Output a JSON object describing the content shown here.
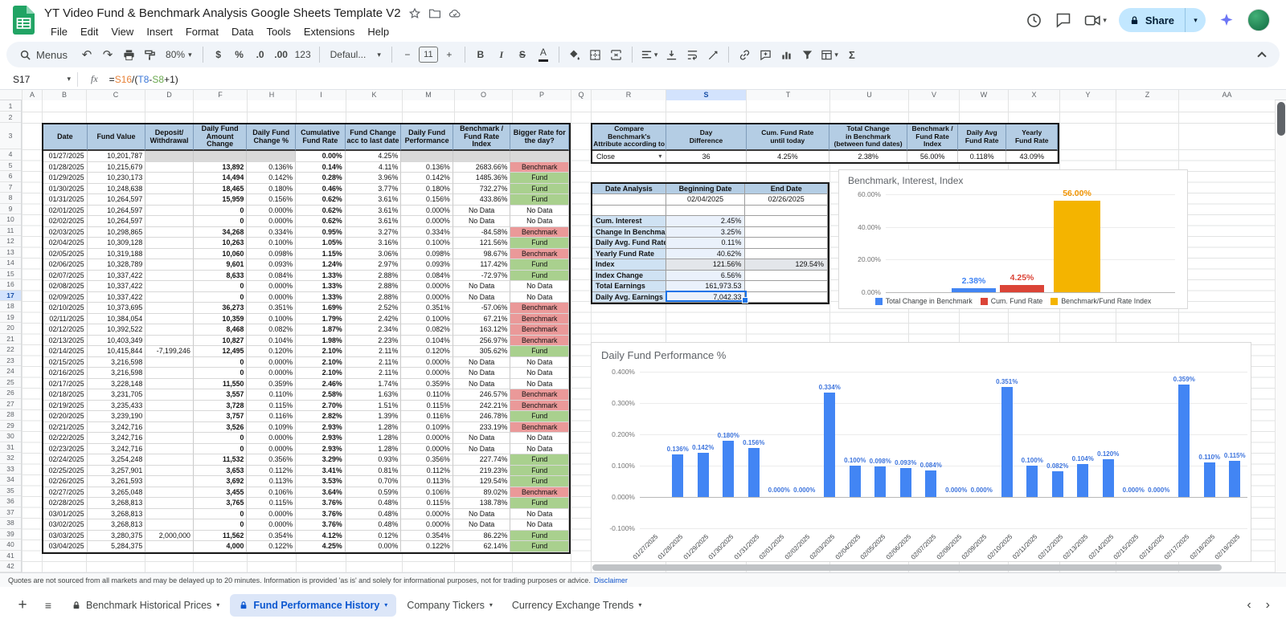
{
  "topbar": {
    "title": "YT Video Fund & Benchmark Analysis Google Sheets Template V2",
    "share_label": "Share",
    "menu_items": [
      "File",
      "Edit",
      "View",
      "Insert",
      "Format",
      "Data",
      "Tools",
      "Extensions",
      "Help"
    ]
  },
  "toolbar": {
    "menus_label": "Menus",
    "zoom_value": "80%",
    "currency_label": "$",
    "percent_label": "%",
    "decrease_decimal_label": ".0",
    "increase_decimal_label": ".00",
    "number_format_label": "123",
    "font_value": "Defaul...",
    "font_size_value": "11",
    "decrease_font_label": "−",
    "increase_font_label": "+",
    "bold_label": "B",
    "italic_label": "I",
    "strikethrough_label": "S",
    "text_color_label": "A",
    "functions_label": "Σ"
  },
  "formula_bar": {
    "cell_ref": "S17",
    "fx_label": "fx",
    "formula_segments": [
      {
        "text": "=",
        "color": "#222222"
      },
      {
        "text": "S16",
        "color": "#e8833a"
      },
      {
        "text": "/(",
        "color": "#222222"
      },
      {
        "text": "T8",
        "color": "#3c78d8"
      },
      {
        "text": "-",
        "color": "#222222"
      },
      {
        "text": "S8",
        "color": "#6aa84f"
      },
      {
        "text": "+1)",
        "color": "#222222"
      }
    ]
  },
  "grid": {
    "column_letters": [
      "A",
      "B",
      "C",
      "D",
      "F",
      "H",
      "I",
      "K",
      "M",
      "O",
      "P",
      "Q",
      "R",
      "S",
      "T",
      "U",
      "V",
      "W",
      "X",
      "Y",
      "Z",
      "AA"
    ],
    "row_count": 42,
    "selected_column": "S",
    "selected_row": 17
  },
  "main_table": {
    "headers": [
      "Date",
      "Fund Value",
      "Deposit/\nWithdrawal",
      "Daily Fund Amount Change",
      "Daily Fund Change %",
      "Cumulative Fund Rate",
      "Fund Change acc to last date",
      "Daily Fund Performance",
      "Benchmark / Fund Rate Index",
      "Bigger Rate for the day?"
    ],
    "rows": [
      [
        "01/27/2025",
        "10,201,787",
        "",
        "",
        "",
        "0.00%",
        "4.25%",
        "",
        "",
        ""
      ],
      [
        "01/28/2025",
        "10,215,679",
        "",
        "13,892",
        "0.136%",
        "0.14%",
        "4.11%",
        "0.136%",
        "2683.66%",
        "Benchmark"
      ],
      [
        "01/29/2025",
        "10,230,173",
        "",
        "14,494",
        "0.142%",
        "0.28%",
        "3.96%",
        "0.142%",
        "1485.36%",
        "Fund"
      ],
      [
        "01/30/2025",
        "10,248,638",
        "",
        "18,465",
        "0.180%",
        "0.46%",
        "3.77%",
        "0.180%",
        "732.27%",
        "Fund"
      ],
      [
        "01/31/2025",
        "10,264,597",
        "",
        "15,959",
        "0.156%",
        "0.62%",
        "3.61%",
        "0.156%",
        "433.86%",
        "Fund"
      ],
      [
        "02/01/2025",
        "10,264,597",
        "",
        "0",
        "0.000%",
        "0.62%",
        "3.61%",
        "0.000%",
        "No Data",
        "No Data"
      ],
      [
        "02/02/2025",
        "10,264,597",
        "",
        "0",
        "0.000%",
        "0.62%",
        "3.61%",
        "0.000%",
        "No Data",
        "No Data"
      ],
      [
        "02/03/2025",
        "10,298,865",
        "",
        "34,268",
        "0.334%",
        "0.95%",
        "3.27%",
        "0.334%",
        "-84.58%",
        "Benchmark"
      ],
      [
        "02/04/2025",
        "10,309,128",
        "",
        "10,263",
        "0.100%",
        "1.05%",
        "3.16%",
        "0.100%",
        "121.56%",
        "Fund"
      ],
      [
        "02/05/2025",
        "10,319,188",
        "",
        "10,060",
        "0.098%",
        "1.15%",
        "3.06%",
        "0.098%",
        "98.67%",
        "Benchmark"
      ],
      [
        "02/06/2025",
        "10,328,789",
        "",
        "9,601",
        "0.093%",
        "1.24%",
        "2.97%",
        "0.093%",
        "117.42%",
        "Fund"
      ],
      [
        "02/07/2025",
        "10,337,422",
        "",
        "8,633",
        "0.084%",
        "1.33%",
        "2.88%",
        "0.084%",
        "-72.97%",
        "Fund"
      ],
      [
        "02/08/2025",
        "10,337,422",
        "",
        "0",
        "0.000%",
        "1.33%",
        "2.88%",
        "0.000%",
        "No Data",
        "No Data"
      ],
      [
        "02/09/2025",
        "10,337,422",
        "",
        "0",
        "0.000%",
        "1.33%",
        "2.88%",
        "0.000%",
        "No Data",
        "No Data"
      ],
      [
        "02/10/2025",
        "10,373,695",
        "",
        "36,273",
        "0.351%",
        "1.69%",
        "2.52%",
        "0.351%",
        "-57.06%",
        "Benchmark"
      ],
      [
        "02/11/2025",
        "10,384,054",
        "",
        "10,359",
        "0.100%",
        "1.79%",
        "2.42%",
        "0.100%",
        "67.21%",
        "Benchmark"
      ],
      [
        "02/12/2025",
        "10,392,522",
        "",
        "8,468",
        "0.082%",
        "1.87%",
        "2.34%",
        "0.082%",
        "163.12%",
        "Benchmark"
      ],
      [
        "02/13/2025",
        "10,403,349",
        "",
        "10,827",
        "0.104%",
        "1.98%",
        "2.23%",
        "0.104%",
        "256.97%",
        "Benchmark"
      ],
      [
        "02/14/2025",
        "10,415,844",
        "-7,199,246",
        "12,495",
        "0.120%",
        "2.10%",
        "2.11%",
        "0.120%",
        "305.62%",
        "Fund"
      ],
      [
        "02/15/2025",
        "3,216,598",
        "",
        "0",
        "0.000%",
        "2.10%",
        "2.11%",
        "0.000%",
        "No Data",
        "No Data"
      ],
      [
        "02/16/2025",
        "3,216,598",
        "",
        "0",
        "0.000%",
        "2.10%",
        "2.11%",
        "0.000%",
        "No Data",
        "No Data"
      ],
      [
        "02/17/2025",
        "3,228,148",
        "",
        "11,550",
        "0.359%",
        "2.46%",
        "1.74%",
        "0.359%",
        "No Data",
        "No Data"
      ],
      [
        "02/18/2025",
        "3,231,705",
        "",
        "3,557",
        "0.110%",
        "2.58%",
        "1.63%",
        "0.110%",
        "246.57%",
        "Benchmark"
      ],
      [
        "02/19/2025",
        "3,235,433",
        "",
        "3,728",
        "0.115%",
        "2.70%",
        "1.51%",
        "0.115%",
        "242.21%",
        "Benchmark"
      ],
      [
        "02/20/2025",
        "3,239,190",
        "",
        "3,757",
        "0.116%",
        "2.82%",
        "1.39%",
        "0.116%",
        "246.78%",
        "Fund"
      ],
      [
        "02/21/2025",
        "3,242,716",
        "",
        "3,526",
        "0.109%",
        "2.93%",
        "1.28%",
        "0.109%",
        "233.19%",
        "Benchmark"
      ],
      [
        "02/22/2025",
        "3,242,716",
        "",
        "0",
        "0.000%",
        "2.93%",
        "1.28%",
        "0.000%",
        "No Data",
        "No Data"
      ],
      [
        "02/23/2025",
        "3,242,716",
        "",
        "0",
        "0.000%",
        "2.93%",
        "1.28%",
        "0.000%",
        "No Data",
        "No Data"
      ],
      [
        "02/24/2025",
        "3,254,248",
        "",
        "11,532",
        "0.356%",
        "3.29%",
        "0.93%",
        "0.356%",
        "227.74%",
        "Fund"
      ],
      [
        "02/25/2025",
        "3,257,901",
        "",
        "3,653",
        "0.112%",
        "3.41%",
        "0.81%",
        "0.112%",
        "219.23%",
        "Fund"
      ],
      [
        "02/26/2025",
        "3,261,593",
        "",
        "3,692",
        "0.113%",
        "3.53%",
        "0.70%",
        "0.113%",
        "129.54%",
        "Fund"
      ],
      [
        "02/27/2025",
        "3,265,048",
        "",
        "3,455",
        "0.106%",
        "3.64%",
        "0.59%",
        "0.106%",
        "89.02%",
        "Benchmark"
      ],
      [
        "02/28/2025",
        "3,268,813",
        "",
        "3,765",
        "0.115%",
        "3.76%",
        "0.48%",
        "0.115%",
        "138.78%",
        "Fund"
      ],
      [
        "03/01/2025",
        "3,268,813",
        "",
        "0",
        "0.000%",
        "3.76%",
        "0.48%",
        "0.000%",
        "No Data",
        "No Data"
      ],
      [
        "03/02/2025",
        "3,268,813",
        "",
        "0",
        "0.000%",
        "3.76%",
        "0.48%",
        "0.000%",
        "No Data",
        "No Data"
      ],
      [
        "03/03/2025",
        "3,280,375",
        "2,000,000",
        "11,562",
        "0.354%",
        "4.12%",
        "0.12%",
        "0.354%",
        "86.22%",
        "Fund"
      ],
      [
        "03/04/2025",
        "5,284,375",
        "",
        "4,000",
        "0.122%",
        "4.25%",
        "0.00%",
        "0.122%",
        "62.14%",
        "Fund"
      ]
    ]
  },
  "compare_table": {
    "headers": [
      "Compare Benchmark's\nAttribute according to",
      "Day\nDifference",
      "Cum. Fund Rate\nuntil today",
      "Total Change\nin Benchmark\n(between fund dates)",
      "Benchmark /\nFund Rate Index",
      "Daily Avg\nFund Rate",
      "Yearly\nFund Rate"
    ],
    "values": [
      "Close",
      "36",
      "4.25%",
      "2.38%",
      "56.00%",
      "0.118%",
      "43.09%"
    ]
  },
  "date_analysis": {
    "title": "Date Analysis",
    "beginning_label": "Beginning Date",
    "end_label": "End Date",
    "beginning_value": "02/04/2025",
    "end_value": "02/26/2025",
    "rows": [
      {
        "label": "Cum. Interest",
        "value": "2.45%",
        "value2": ""
      },
      {
        "label": "Change In Benchmark",
        "value": "3.25%",
        "value2": ""
      },
      {
        "label": "Daily Avg. Fund Rate",
        "value": "0.11%",
        "value2": ""
      },
      {
        "label": "Yearly Fund Rate",
        "value": "40.62%",
        "value2": ""
      },
      {
        "label": "Index",
        "value": "121.56%",
        "value2": "129.54%"
      },
      {
        "label": "Index Change",
        "value": "6.56%",
        "value2": ""
      },
      {
        "label": "Total Earnings",
        "value": "161,973.53",
        "value2": ""
      },
      {
        "label": "Daily Avg. Earnings",
        "value": "7,042.33",
        "value2": "",
        "selected": true
      }
    ]
  },
  "chart_data": [
    {
      "type": "bar",
      "title": "Benchmark, Interest, Index",
      "categories": [
        "Total Change in Benchmark",
        "Cum. Fund Rate",
        "Benchmark/Fund Rate Index"
      ],
      "values": [
        2.38,
        4.25,
        56.0
      ],
      "value_labels": [
        "2.38%",
        "4.25%",
        "56.00%"
      ],
      "colors": [
        "#4285f4",
        "#db4437",
        "#f4b400"
      ],
      "label_colors": [
        "#4285f4",
        "#db4437",
        "#f09300"
      ],
      "ylim": [
        0,
        60
      ],
      "yticks": [
        "0.00%",
        "20.00%",
        "40.00%",
        "60.00%"
      ],
      "legend": [
        "Total Change in Benchmark",
        "Cum. Fund Rate",
        "Benchmark/Fund Rate Index"
      ],
      "legend_position": "bottom"
    },
    {
      "type": "bar",
      "title": "Daily Fund Performance %",
      "categories": [
        "01/27/2025",
        "01/28/2025",
        "01/29/2025",
        "01/30/2025",
        "01/31/2025",
        "02/01/2025",
        "02/02/2025",
        "02/03/2025",
        "02/04/2025",
        "02/05/2025",
        "02/06/2025",
        "02/07/2025",
        "02/08/2025",
        "02/09/2025",
        "02/10/2025",
        "02/11/2025",
        "02/12/2025",
        "02/13/2025",
        "02/14/2025",
        "02/15/2025",
        "02/16/2025",
        "02/17/2025",
        "02/18/2025",
        "02/19/2025"
      ],
      "values": [
        null,
        0.136,
        0.142,
        0.18,
        0.156,
        0.0,
        0.0,
        0.334,
        0.1,
        0.098,
        0.093,
        0.084,
        0.0,
        0.0,
        0.351,
        0.1,
        0.082,
        0.104,
        0.12,
        0.0,
        0.0,
        0.359,
        0.11,
        0.115
      ],
      "value_labels": [
        "",
        "0.136%",
        "0.142%",
        "0.180%",
        "0.156%",
        "0.000%",
        "0.000%",
        "0.334%",
        "0.100%",
        "0.098%",
        "0.093%",
        "0.084%",
        "0.000%",
        "0.000%",
        "0.351%",
        "0.100%",
        "0.082%",
        "0.104%",
        "0.120%",
        "0.000%",
        "0.000%",
        "0.359%",
        "0.110%",
        "0.115%"
      ],
      "bar_color": "#4285f4",
      "label_color": "#3d74dd",
      "ylim": [
        -0.1,
        0.4
      ],
      "yticks": [
        "0.400%",
        "0.300%",
        "0.200%",
        "0.100%",
        "0.000%",
        "-0.100%"
      ],
      "grid": true,
      "legend_position": "none"
    }
  ],
  "statusbar": {
    "disclaimer_text": "Quotes are not sourced from all markets and may be delayed up to 20 minutes. Information is provided 'as is' and solely for informational purposes, not for trading purposes or advice.",
    "disclaimer_link": "Disclaimer"
  },
  "tabbar": {
    "tabs": [
      {
        "label": "Benchmark Historical Prices",
        "locked": true,
        "active": false
      },
      {
        "label": "Fund Performance History",
        "locked": true,
        "active": true
      },
      {
        "label": "Company Tickers",
        "locked": false,
        "active": false
      },
      {
        "label": "Currency Exchange Trends",
        "locked": false,
        "active": false
      }
    ]
  },
  "icons": {
    "dropdown": "▾",
    "add_sheet": "+",
    "all_sheets": "≡",
    "undo": "↶",
    "redo": "↷",
    "scroll_left": "‹",
    "scroll_right": "›"
  },
  "colors": {
    "accent_blue": "#1a73e8",
    "table_header_fill": "#b4cde4",
    "benchmark_fill": "#ea9999",
    "fund_fill": "#a9d08e",
    "selected_header_fill": "#d3e3fd",
    "chart_blue": "#4285f4",
    "chart_red": "#db4437",
    "chart_yellow": "#f4b400"
  }
}
